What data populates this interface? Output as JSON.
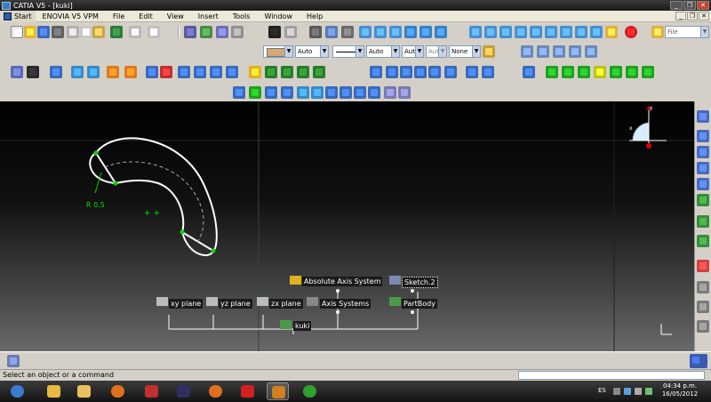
{
  "window": {
    "title": "CATIA V5 - [kuki]",
    "minimize": "_",
    "restore": "❐",
    "close": "✕"
  },
  "menu": {
    "items": [
      "Start",
      "ENOVIA V5 VPM",
      "File",
      "Edit",
      "View",
      "Insert",
      "Tools",
      "Window",
      "Help"
    ],
    "doc_min": "_",
    "doc_restore": "❐",
    "doc_close": "✕"
  },
  "toolbar": {
    "file_combo": "File",
    "line_weight": "Auto",
    "line_type": "Auto",
    "layer_combo": "Aut",
    "layer_combo2": "Aut",
    "none_combo": "None",
    "color_combo": "Auto"
  },
  "viewport": {
    "radius_label": "R 0.5",
    "compass_labels": {
      "x": "x",
      "y": "y"
    },
    "tree": {
      "absolute_axis": "Absolute Axis System",
      "sketch": "Sketch.2",
      "xy": "xy plane",
      "yz": "yz plane",
      "zx": "zx plane",
      "axis_systems": "Axis Systems",
      "partbody": "PartBody",
      "root": "kuki"
    }
  },
  "status": {
    "message": "Select an object or a command"
  },
  "taskbar": {
    "lang": "ES",
    "time": "04:34 p.m.",
    "date": "16/05/2012"
  },
  "colors": {
    "sketch_stroke": "#ffffff",
    "point_green": "#00dd00",
    "swatch": "#d2a878"
  }
}
